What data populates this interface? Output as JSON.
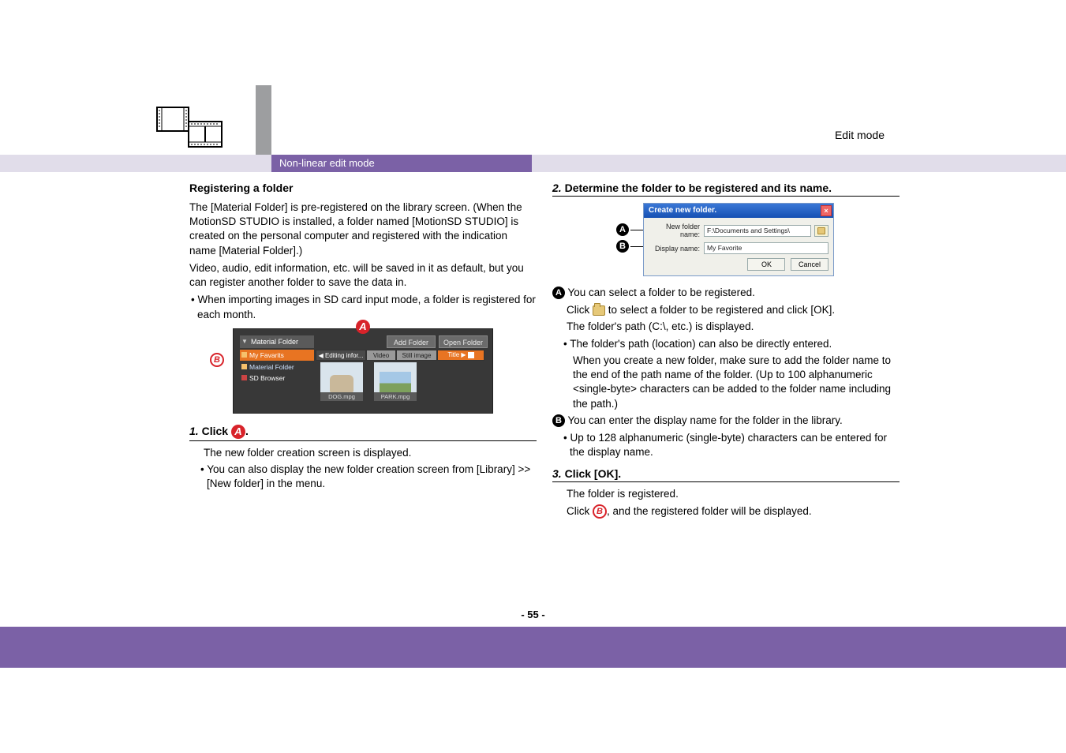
{
  "header": {
    "mode": "Edit mode",
    "section": "Non-linear edit mode"
  },
  "left": {
    "title": "Registering a folder",
    "para1": "The [Material Folder] is pre-registered on the library screen. (When the MotionSD STUDIO is installed, a folder named [MotionSD STUDIO] is created on the personal computer and registered with the indication name [Material Folder].)",
    "para2": "Video, audio, edit information, etc. will be saved in it as default, but you can register another folder to save the data in.",
    "bullet1": "• When importing images in SD card input mode, a folder is registered for each month.",
    "libshot": {
      "title": "Material Folder",
      "addFolder": "Add Folder",
      "openFolder": "Open Folder",
      "favorite": "My Favarits",
      "tabEdit": "◀  Editing infor...",
      "tabVideo": "Video",
      "tabStill": "Still image",
      "tabTitle": "Title ▶",
      "sideMaterial": "Material Folder",
      "sideSD": "SD Browser",
      "thumb1": "DOG.mpg",
      "thumb2": "PARK.mpg"
    },
    "step1_pre": "Click ",
    "step1_post": ".",
    "step1_sub": "The new folder creation screen is displayed.",
    "step1_bul": "• You can also display the new folder creation screen from [Library] >> [New folder] in the menu."
  },
  "right": {
    "step2": "Determine the folder to be registered and its name.",
    "dialog": {
      "title": "Create new folder.",
      "label1": "New folder name:",
      "value1": "F:\\Documents and Settings\\",
      "label2": "Display name:",
      "value2": "My Favorite",
      "ok": "OK",
      "cancel": "Cancel"
    },
    "a_text": "You can select a folder to be registered.",
    "a_sub1a": "Click ",
    "a_sub1b": " to select a folder to be registered and click [OK].",
    "a_sub2": "The folder's path (C:\\, etc.) is displayed.",
    "a_bul": "• The folder's path (location) can also be directly entered.",
    "a_sub3": "When you create a new folder, make sure to add the folder name to the end of the path name of the folder. (Up to 100 alphanumeric <single-byte> characters can be added to the folder name including the path.)",
    "b_text": "You can enter the display name for the folder in the library.",
    "b_bul": "• Up to 128 alphanumeric (single-byte) characters can be entered for the display name.",
    "step3": "Click [OK].",
    "step3_sub": "The folder is registered.",
    "step3_sub2a": "Click ",
    "step3_sub2b": ", and the registered folder will be displayed."
  },
  "badges": {
    "A": "A",
    "B": "B"
  },
  "page": "- 55 -"
}
